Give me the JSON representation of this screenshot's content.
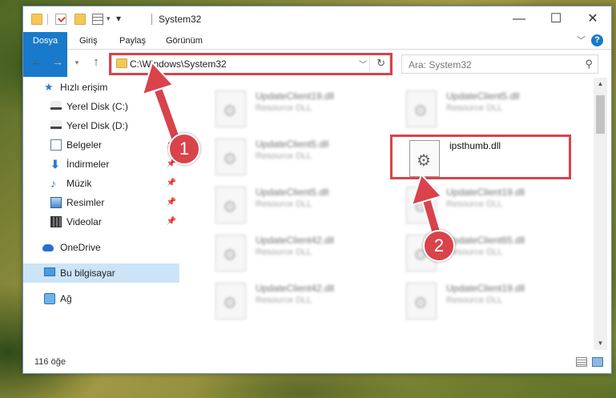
{
  "window": {
    "title": "System32"
  },
  "ribbon": {
    "tabs": [
      "Dosya",
      "Giriş",
      "Paylaş",
      "Görünüm"
    ]
  },
  "nav": {
    "address": "C:\\Windows\\System32",
    "search_placeholder": "Ara: System32"
  },
  "sidebar": {
    "items": [
      {
        "label": "Hızlı erişim",
        "icon": "star-icon"
      },
      {
        "label": "Yerel Disk (C:)",
        "icon": "drive-icon"
      },
      {
        "label": "Yerel Disk (D:)",
        "icon": "drive-icon",
        "pinned": true
      },
      {
        "label": "Belgeler",
        "icon": "document-icon",
        "pinned": true
      },
      {
        "label": "İndirmeler",
        "icon": "download-icon",
        "pinned": true
      },
      {
        "label": "Müzik",
        "icon": "music-icon",
        "pinned": true
      },
      {
        "label": "Resimler",
        "icon": "pictures-icon",
        "pinned": true
      },
      {
        "label": "Videolar",
        "icon": "video-icon",
        "pinned": true
      },
      {
        "label": "OneDrive",
        "icon": "cloud-icon"
      },
      {
        "label": "Bu bilgisayar",
        "icon": "computer-icon",
        "selected": true
      },
      {
        "label": "Ağ",
        "icon": "network-icon"
      }
    ]
  },
  "files": [
    {
      "name": "UpdateClient19.dll",
      "type": "Resource DLL"
    },
    {
      "name": "UpdateClient5.dll",
      "type": "Resource DLL"
    },
    {
      "name": "UpdateClient5.dll",
      "type": "Resource DLL"
    },
    {
      "name": "ipsthumb.dll",
      "type": ""
    },
    {
      "name": "UpdateClient5.dll",
      "type": "Resource DLL"
    },
    {
      "name": "UpdateClient19.dll",
      "type": "Resource DLL"
    },
    {
      "name": "UpdateClient42.dll",
      "type": "Resource DLL"
    },
    {
      "name": "UpdateClient65.dll",
      "type": "Resource DLL"
    },
    {
      "name": "UpdateClient42.dll",
      "type": "Resource DLL"
    },
    {
      "name": "UpdateClient19.dll",
      "type": "Resource DLL"
    }
  ],
  "status": {
    "count": "116 öğe"
  },
  "annotations": {
    "step1": "1",
    "step2": "2",
    "color": "#d9434b"
  }
}
